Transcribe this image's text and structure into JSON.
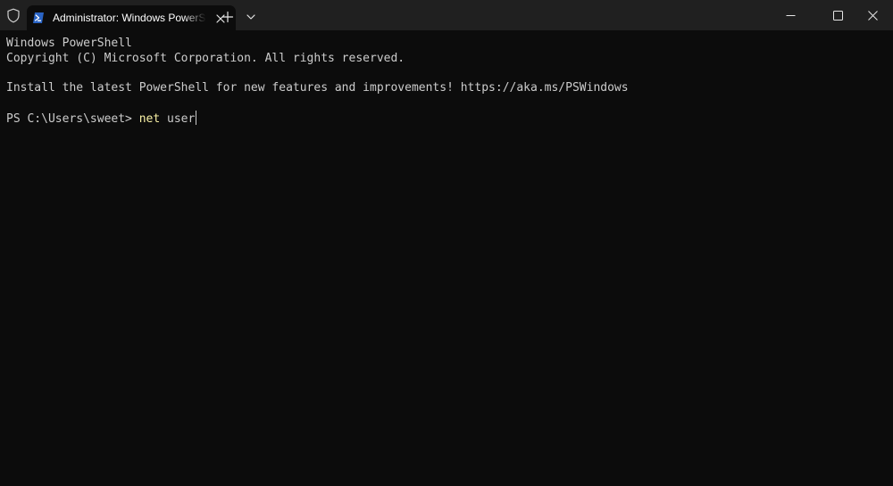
{
  "tab": {
    "title": "Administrator: Windows PowerShell",
    "icon": "powershell-icon"
  },
  "titlebar": {
    "shield_icon": "shield-icon",
    "new_tab_icon": "plus-icon",
    "dropdown_icon": "chevron-down-icon",
    "minimize_icon": "minimize-icon",
    "maximize_icon": "maximize-icon",
    "close_icon": "close-icon"
  },
  "terminal": {
    "lines": [
      "Windows PowerShell",
      "Copyright (C) Microsoft Corporation. All rights reserved.",
      "Install the latest PowerShell for new features and improvements! https://aka.ms/PSWindows"
    ],
    "prompt": "PS C:\\Users\\sweet> ",
    "command": "net",
    "argument": " user"
  },
  "colors": {
    "background": "#0c0c0c",
    "titlebar": "#202020",
    "text": "#cccccc",
    "command": "#f9f1a5",
    "powershell_icon_bg": "#2a64c5"
  }
}
